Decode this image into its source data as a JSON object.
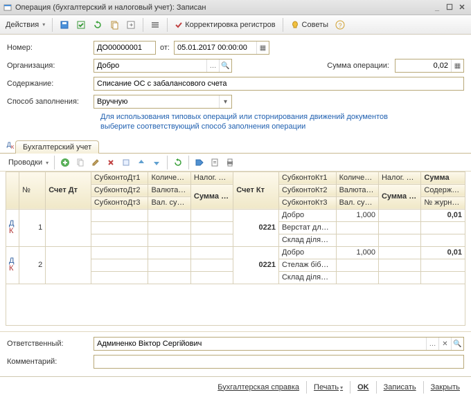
{
  "window": {
    "title": "Операция (бухгалтерский и налоговый учет): Записан"
  },
  "toolbar": {
    "actions": "Действия",
    "correct": "Корректировка регистров",
    "tips": "Советы"
  },
  "form": {
    "number_label": "Номер:",
    "number": "ДО00000001",
    "from": "от:",
    "date": "05.01.2017 00:00:00",
    "org_label": "Организация:",
    "org": "Добро",
    "sum_op_label": "Сумма операции:",
    "sum_op": "0,02",
    "content_label": "Содержание:",
    "content": "Списание ОС с забалансового счета",
    "fill_label": "Способ заполнения:",
    "fill": "Вручную",
    "hint1": "Для использования типовых операций или сторнирования движений документов",
    "hint2": "выберите соответствующий способ заполнения операции"
  },
  "tab": {
    "label": "Бухгалтерский учет"
  },
  "posting": {
    "label": "Проводки"
  },
  "headers": {
    "n": "№",
    "acc_dt": "Счет Дт",
    "sub1": "СубконтоДт1",
    "sub2": "СубконтоДт2",
    "sub3": "СубконтоДт3",
    "qty": "Количес…",
    "cur": "Валюта…",
    "curq": "Вал. су…",
    "tax": "Налог. н…",
    "sum_dt": "Сумма (н/у) Дт",
    "acc_ct": "Счет Кт",
    "subk1": "СубконтоКт1",
    "subk2": "СубконтоКт2",
    "subk3": "СубконтоКт3",
    "sum_ct": "Сумма (н/у) Кт",
    "sum": "Сумма",
    "cont": "Содерж…",
    "jrn": "№ журн…"
  },
  "rows": {
    "r1": {
      "n": "1",
      "ct": "0221",
      "sk1": "Добро",
      "sk2": "Верстат дл…",
      "sk3": "Склад діля…",
      "qty": "1,000",
      "sum": "0,01"
    },
    "r2": {
      "n": "2",
      "ct": "0221",
      "sk1": "Добро",
      "sk2": "Стелаж біб…",
      "sk3": "Склад діля…",
      "qty": "1,000",
      "sum": "0,01"
    }
  },
  "bottom": {
    "resp_label": "Ответственный:",
    "resp": "Админенко Віктор Сергійович",
    "comment_label": "Комментарий:",
    "comment": ""
  },
  "buttons": {
    "report": "Бухгалтерская справка",
    "print": "Печать",
    "ok": "OK",
    "write": "Записать",
    "close": "Закрыть"
  }
}
